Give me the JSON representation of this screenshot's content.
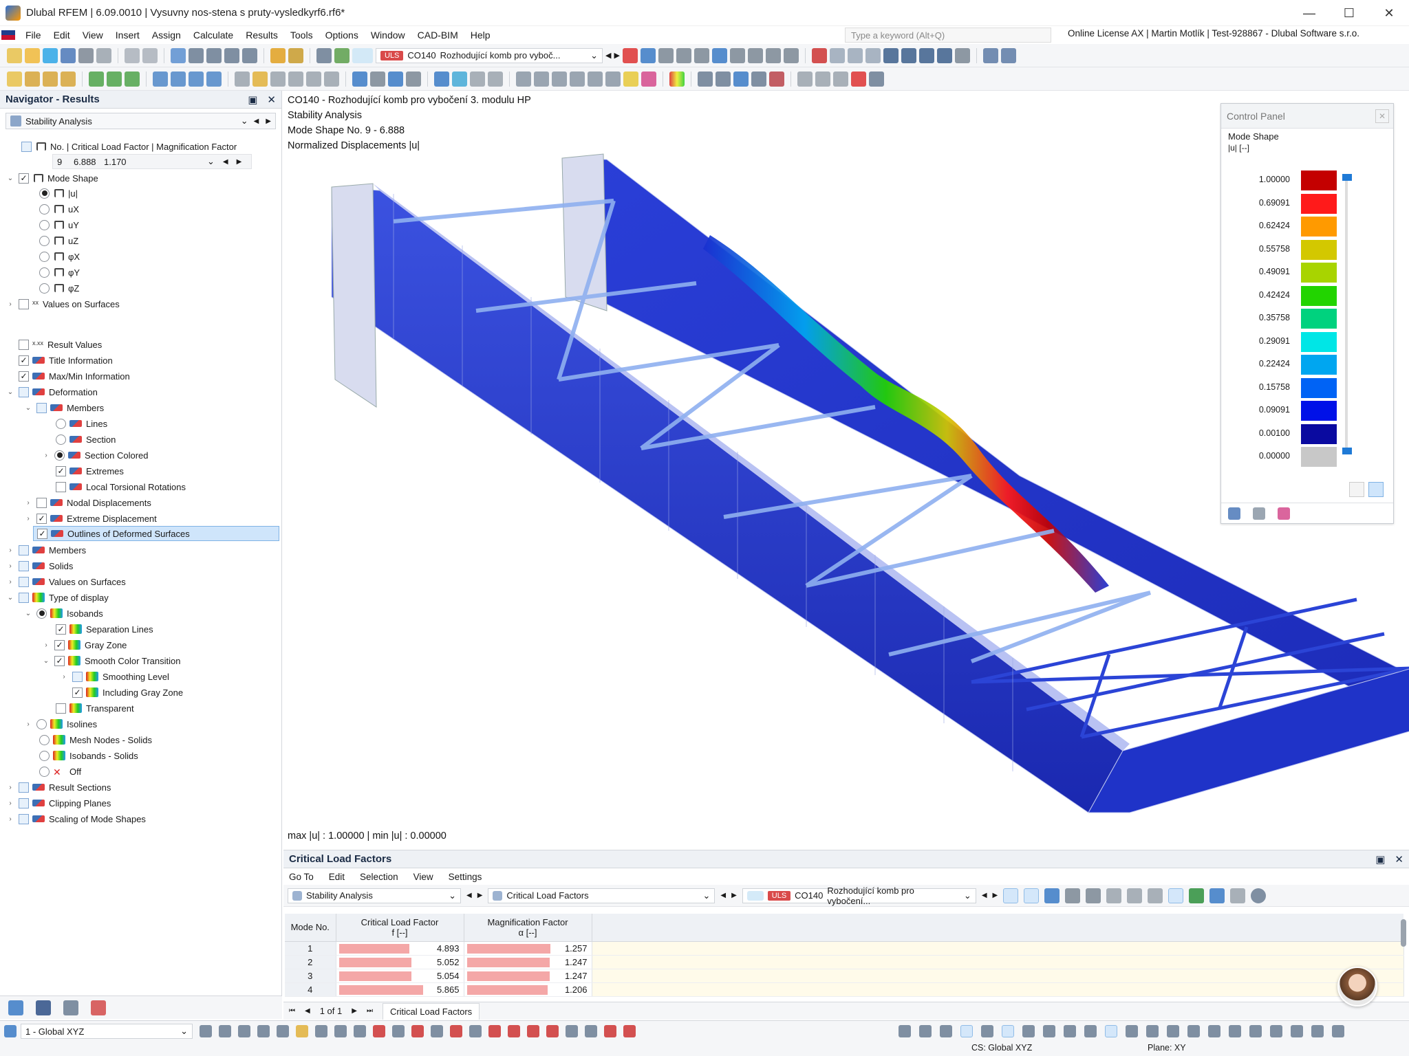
{
  "window": {
    "title": "Dlubal RFEM | 6.09.0010 | Vysuvny nos-stena s pruty-vysledkyrf6.rf6*"
  },
  "menu": [
    "File",
    "Edit",
    "View",
    "Insert",
    "Assign",
    "Calculate",
    "Results",
    "Tools",
    "Options",
    "Window",
    "CAD-BIM",
    "Help"
  ],
  "search": {
    "placeholder": "Type a keyword (Alt+Q)"
  },
  "license": "Online License AX | Martin Motlík | Test-928867 - Dlubal Software s.r.o.",
  "toolbar": {
    "uls": "ULS",
    "combo_id": "CO140",
    "combo_name": "Rozhodující komb pro vyboč..."
  },
  "navigator": {
    "title": "Navigator - Results",
    "analysis": "Stability Analysis",
    "header_label": "No. | Critical Load Factor | Magnification Factor",
    "selected_mode": {
      "no": "9",
      "factor": "6.888",
      "mag": "1.170"
    },
    "items": [
      {
        "label": "Mode Shape"
      },
      {
        "label": "|u|"
      },
      {
        "label": "uX"
      },
      {
        "label": "uY"
      },
      {
        "label": "uZ"
      },
      {
        "label": "φX"
      },
      {
        "label": "φY"
      },
      {
        "label": "φZ"
      },
      {
        "label": "Values on Surfaces"
      },
      {
        "label": "Result Values"
      },
      {
        "label": "Title Information"
      },
      {
        "label": "Max/Min Information"
      },
      {
        "label": "Deformation"
      },
      {
        "label": "Members"
      },
      {
        "label": "Lines"
      },
      {
        "label": "Section"
      },
      {
        "label": "Section Colored"
      },
      {
        "label": "Extremes"
      },
      {
        "label": "Local Torsional Rotations"
      },
      {
        "label": "Nodal Displacements"
      },
      {
        "label": "Extreme Displacement"
      },
      {
        "label": "Outlines of Deformed Surfaces"
      },
      {
        "label": "Members"
      },
      {
        "label": "Solids"
      },
      {
        "label": "Values on Surfaces"
      },
      {
        "label": "Type of display"
      },
      {
        "label": "Isobands"
      },
      {
        "label": "Separation Lines"
      },
      {
        "label": "Gray Zone"
      },
      {
        "label": "Smooth Color Transition"
      },
      {
        "label": "Smoothing Level"
      },
      {
        "label": "Including Gray Zone"
      },
      {
        "label": "Transparent"
      },
      {
        "label": "Isolines"
      },
      {
        "label": "Mesh Nodes - Solids"
      },
      {
        "label": "Isobands - Solids"
      },
      {
        "label": "Off"
      },
      {
        "label": "Result Sections"
      },
      {
        "label": "Clipping Planes"
      },
      {
        "label": "Scaling of Mode Shapes"
      }
    ]
  },
  "viewport": {
    "info": [
      "CO140 - Rozhodující komb pro vybočení 3. modulu HP",
      "Stability Analysis",
      "Mode Shape No. 9 - 6.888",
      "Normalized Displacements |u|"
    ],
    "maxmin": "max |u| : 1.00000 | min |u| : 0.00000"
  },
  "control_panel": {
    "title": "Control Panel",
    "section": "Mode Shape",
    "unit": "|u| [--]",
    "legend": [
      {
        "value": "1.00000",
        "color": "#c40000"
      },
      {
        "value": "0.69091",
        "color": "#ff1a1a"
      },
      {
        "value": "0.62424",
        "color": "#ff9a00"
      },
      {
        "value": "0.55758",
        "color": "#d3c800"
      },
      {
        "value": "0.49091",
        "color": "#a8d400"
      },
      {
        "value": "0.42424",
        "color": "#22d400"
      },
      {
        "value": "0.35758",
        "color": "#00d27e"
      },
      {
        "value": "0.29091",
        "color": "#00e6e6"
      },
      {
        "value": "0.22424",
        "color": "#00a6f0"
      },
      {
        "value": "0.15758",
        "color": "#0063f5"
      },
      {
        "value": "0.09091",
        "color": "#0011e8"
      },
      {
        "value": "0.00100",
        "color": "#0a0aa0"
      },
      {
        "value": "0.00000",
        "color": "#c8c8c8"
      }
    ]
  },
  "results_panel": {
    "title": "Critical Load Factors",
    "menu": [
      "Go To",
      "Edit",
      "Selection",
      "View",
      "Settings"
    ],
    "analysis": "Stability Analysis",
    "table_type": "Critical Load Factors",
    "uls": "ULS",
    "combo_id": "CO140",
    "combo_name": "Rozhodující komb pro vybočení...",
    "columns": {
      "mode": "Mode No.",
      "clf": "Critical Load Factor",
      "clf_unit": "f [--]",
      "mag": "Magnification Factor",
      "mag_unit": "α [--]"
    },
    "rows": [
      {
        "no": "1",
        "clf": "4.893",
        "mag": "1.257",
        "clf_frac": 0.835,
        "mag_frac": 0.995
      },
      {
        "no": "2",
        "clf": "5.052",
        "mag": "1.247",
        "clf_frac": 0.862,
        "mag_frac": 0.987
      },
      {
        "no": "3",
        "clf": "5.054",
        "mag": "1.247",
        "clf_frac": 0.862,
        "mag_frac": 0.987
      },
      {
        "no": "4",
        "clf": "5.865",
        "mag": "1.206",
        "clf_frac": 1.0,
        "mag_frac": 0.955
      }
    ],
    "pager": "1 of 1",
    "tab": "Critical Load Factors"
  },
  "status": {
    "cs": "1 - Global XYZ",
    "cs_global": "CS: Global XYZ",
    "plane": "Plane: XY"
  }
}
